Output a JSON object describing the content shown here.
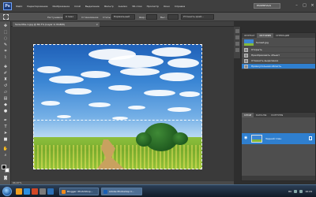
{
  "app": {
    "logo": "Ps",
    "menu": [
      "Файл",
      "Редактирование",
      "Изображение",
      "Слой",
      "Выделение",
      "Фильтр",
      "Анализ",
      "3D-слои",
      "Просмотр",
      "Окно",
      "Справка"
    ],
    "workspace": "ESSENTIALS",
    "window_buttons": [
      "–",
      "□",
      "×"
    ]
  },
  "options_bar": {
    "feather_label": "Растушевка:",
    "feather_value": "0 пикс",
    "antialias_label": "Сглаживание",
    "style_label": "Стиль:",
    "style_value": "Нормальный",
    "width_label": "Шир.:",
    "height_label": "Выс.:",
    "refine_button": "Уточнить край..."
  },
  "document": {
    "tab_title": "Sans-title-1.jpg @ 66,7% (Layer 0, RGB/8)",
    "status": "66,67%"
  },
  "history_panel": {
    "tabs": [
      "ЖУРНАЛ",
      "ИСТОРИЯ",
      "ОПЕРАЦИИ"
    ],
    "active_tab": 1,
    "snapshot_name": "Sunset.jpg",
    "steps": [
      "Открыть",
      "Преобразовать объект",
      "Отменить выделение",
      "Прямоугольная область"
    ],
    "selected_step": 3
  },
  "layers_panel": {
    "tabs": [
      "СЛОИ",
      "КАНАЛЫ",
      "КОНТУРЫ"
    ],
    "active_tab": 0,
    "layer_name": "Задний план"
  },
  "taskbar": {
    "tasks": [
      {
        "label": "Blogger: PhotoShop...",
        "color": "#f08a1a"
      },
      {
        "label": "Adobe Photoshop C...",
        "color": "#1a5fb4"
      }
    ],
    "active_task": 1,
    "language": "RU",
    "clock": "10:24"
  },
  "colors": {
    "accent": "#2f7fcf",
    "panel": "#4e4e4e",
    "menubar": "#3f3f3f"
  }
}
